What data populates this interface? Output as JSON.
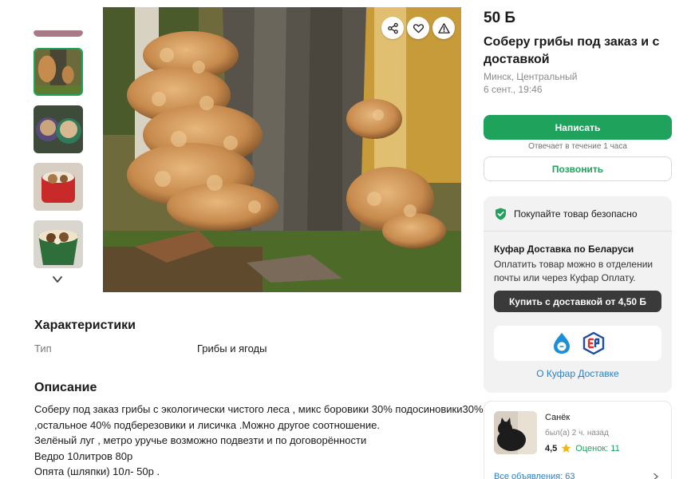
{
  "listing": {
    "price": "50 Б",
    "title": "Соберу грибы под заказ и с доставкой",
    "location": "Минск, Центральный",
    "date": "6 сент., 19:46"
  },
  "actions": {
    "write_label": "Написать",
    "reply_note": "Отвечает в течение 1 часа",
    "call_label": "Позвонить"
  },
  "safe_deal": {
    "headline": "Покупайте товар безопасно",
    "delivery_title": "Куфар Доставка по Беларуси",
    "delivery_text": "Оплатить товар можно в отделении почты или через Куфар Оплату.",
    "buy_button": "Купить с доставкой от 4,50 Б",
    "about_link": "О Куфар Доставке"
  },
  "seller": {
    "name": "Санёк",
    "last_seen": "был(а) 2 ч. назад",
    "rating": "4,5",
    "reviews": "Оценок: 11",
    "all_ads": "Все объявления: 63"
  },
  "characteristics": {
    "title": "Характеристики",
    "rows": [
      {
        "key": "Тип",
        "value": "Грибы и ягоды"
      }
    ]
  },
  "description": {
    "title": "Описание",
    "lines": [
      "Соберу под заказ грибы с экологически чистого леса , микс боровики 30% подосиновики30%",
      ",остальное 40% подберезовики и лисичка .Можно другое соотношение.",
      "Зелёный луг , метро уручье возможно подвезти и по договорённости",
      "Ведро 10литров 80р",
      "Опята (шляпки) 10л- 50р ."
    ]
  },
  "gallery": {
    "active_index": 1,
    "icons": [
      "share-icon",
      "heart-icon",
      "warning-icon",
      "chevron-up-icon",
      "chevron-down-icon"
    ]
  },
  "colors": {
    "accent_green": "#1fa35c",
    "link_blue": "#2a7fc4",
    "dark_button": "#3a3a3a",
    "card_bg": "#f2f2f2"
  }
}
